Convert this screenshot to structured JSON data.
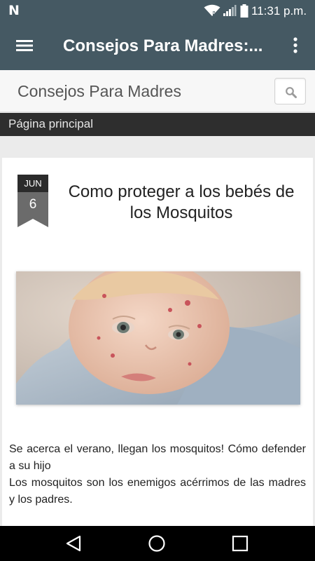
{
  "status_bar": {
    "time": "11:31 p.m.",
    "notification_icon": "N",
    "icons": [
      "wifi-icon",
      "cell-signal-icon",
      "battery-icon"
    ]
  },
  "app_bar": {
    "title": "Consejos Para Madres:...",
    "menu_icon": "hamburger-menu-icon",
    "overflow_icon": "more-vertical-icon"
  },
  "site_header": {
    "title": "Consejos Para Madres",
    "search_icon": "search-icon"
  },
  "nav": {
    "item": "Página principal"
  },
  "post": {
    "date_month": "JUN",
    "date_day": "6",
    "title": "Como proteger a los bebés de los Mosquitos",
    "image_alt": "baby-with-mosquito-bites-photo",
    "excerpt_line1": "Se acerca el verano, llegan los mosquitos! Cómo defender a su hijo",
    "excerpt_line2": "Los mosquitos son los enemigos acérrimos de las madres y los padres."
  },
  "system_nav": {
    "icons": [
      "back-icon",
      "home-icon",
      "recents-icon"
    ]
  },
  "colors": {
    "app_bar": "#455963",
    "nav_bar": "#2e2e2e",
    "background": "#ebebeb"
  }
}
